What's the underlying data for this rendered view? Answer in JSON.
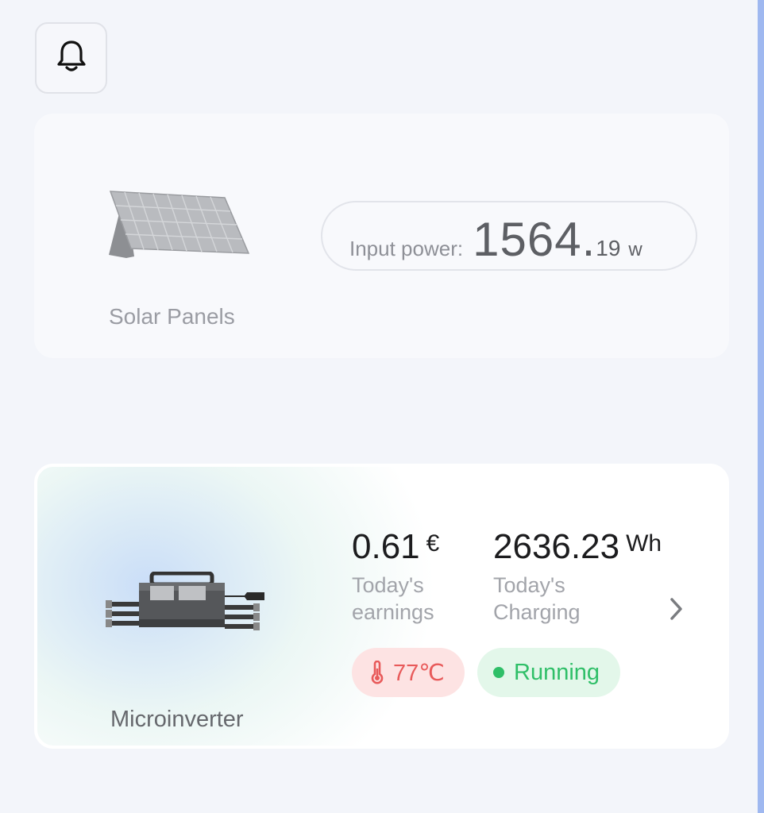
{
  "header": {
    "notification_icon": "bell-icon"
  },
  "solar": {
    "label": "Solar Panels",
    "input_label": "Input power",
    "separator": ":",
    "power_int": "1564.",
    "power_dec": "19",
    "power_unit": "w",
    "image_icon": "solar-panel-icon"
  },
  "inverter": {
    "label": "Microinverter",
    "image_icon": "microinverter-icon",
    "earnings": {
      "value": "0.61",
      "unit": "€",
      "caption": "Today's earnings"
    },
    "charging": {
      "value": "2636.23",
      "unit": "Wh",
      "caption": "Today's Charging"
    },
    "temperature": {
      "value": "77℃",
      "icon": "thermometer-icon"
    },
    "status": {
      "label": "Running",
      "color": "#2fbf68"
    },
    "more_icon": "chevron-right-icon"
  },
  "colors": {
    "accent_edge": "#9fb8f0",
    "temp_red": "#e85a5a",
    "running_green": "#2fbf68"
  }
}
